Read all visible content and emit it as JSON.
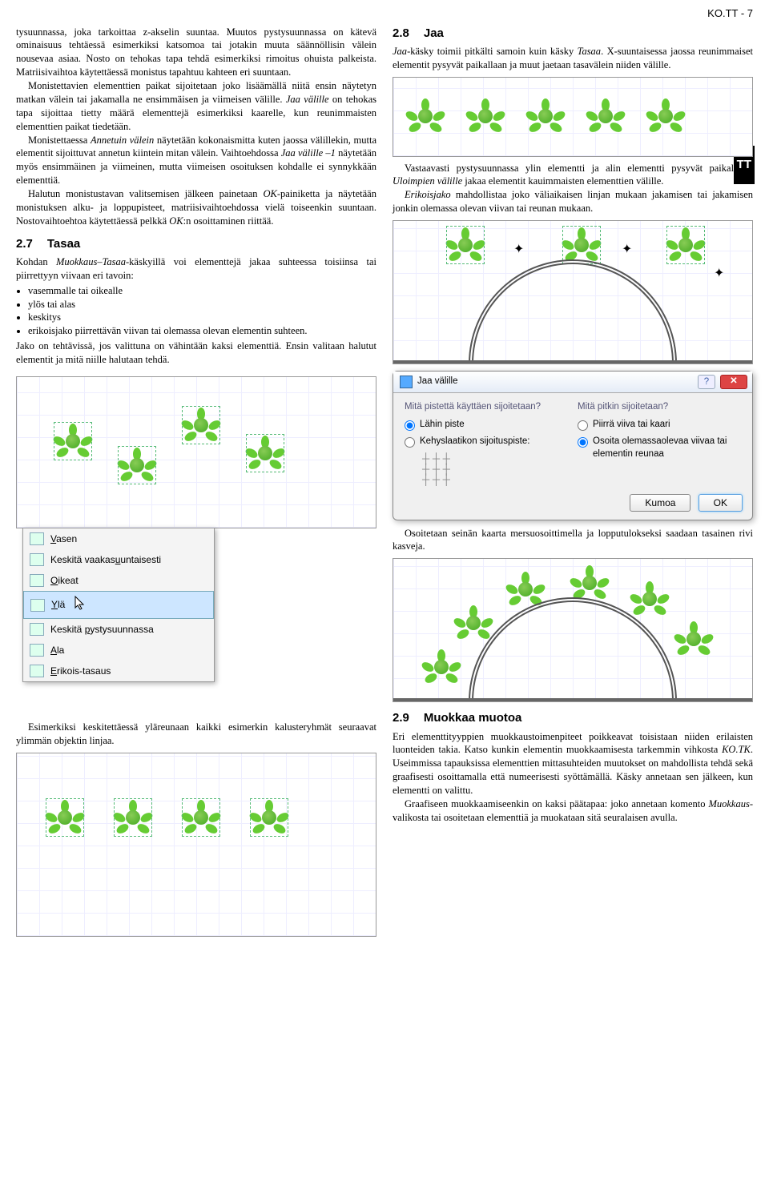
{
  "page_header": "KO.TT - 7",
  "side_tab": "TT",
  "left": {
    "p1": "tysuunnassa, joka tarkoittaa z-akselin suuntaa. Muutos pystysuunnassa on kätevä ominaisuus tehtäessä esimerkiksi katsomoa tai jotakin muuta säännöllisin välein nousevaa asiaa. Nosto on tehokas tapa tehdä esimerkiksi rimoitus ohuista palkeista. Matriisivaihtoa käytettäessä monistus tapahtuu kahteen eri suuntaan.",
    "p2a": "Monistettavien elementtien paikat sijoitetaan joko lisäämällä niitä ensin näytetyn matkan välein tai jakamalla ne ensimmäisen ja viimeisen välille. ",
    "p2b_italic": "Jaa välille",
    "p2c": " on tehokas tapa sijoittaa tietty määrä elementtejä esimerkiksi kaarelle, kun reunimmaisten elementtien paikat tiedetään.",
    "p3a": "Monistettaessa ",
    "p3a_i": "Annetuin välein",
    "p3b": " näytetään kokonaismitta kuten jaossa välillekin, mutta elementit sijoittuvat annetun kiintein mitan välein. Vaihtoehdossa ",
    "p3b_i": "Jaa välille –1",
    "p3c": " näytetään myös ensimmäinen ja viimeinen, mutta viimeisen osoituksen kohdalle ei synnykkään elementtiä.",
    "p4a": "Halutun monistustavan valitsemisen jälkeen painetaan ",
    "p4a_i": "OK",
    "p4b": "-painiketta ja näytetään monistuksen alku- ja loppupisteet, matriisivaihtoehdossa vielä toiseenkin suuntaan. Nostovaihtoehtoa käytettäessä pelkkä ",
    "p4b_i": "OK",
    "p4c": ":n osoittaminen riittää.",
    "sec27_num": "2.7",
    "sec27_title": "Tasaa",
    "p5a": "Kohdan ",
    "p5a_i": "Muokkaus–Tasaa",
    "p5b": "-käskyillä voi elementtejä jakaa suhteessa toisiinsa tai piirrettyyn viivaan eri tavoin:",
    "bullets": [
      "vasemmalle tai oikealle",
      "ylös tai alas",
      "keskitys",
      "erikoisjako piirrettävän viivan tai olemassa olevan elementin suhteen."
    ],
    "p6": "Jako on tehtävissä, jos valittuna on vähintään kaksi elementtiä. Ensin valitaan halutut elementit ja mitä niille halutaan tehdä.",
    "menu_items": [
      {
        "icon": "align-left-icon",
        "label_pre": "",
        "ul": "V",
        "label_post": "asen"
      },
      {
        "icon": "align-hcenter-icon",
        "label_pre": "Keskitä vaakas",
        "ul": "u",
        "label_post": "untaisesti"
      },
      {
        "icon": "align-right-icon",
        "label_pre": "",
        "ul": "O",
        "label_post": "ikeat"
      },
      {
        "icon": "align-top-icon",
        "label_pre": "",
        "ul": "Y",
        "label_post": "lä",
        "highlight": true
      },
      {
        "icon": "align-vcenter-icon",
        "label_pre": "Keskitä ",
        "ul": "p",
        "label_post": "ystysuunnassa"
      },
      {
        "icon": "align-bottom-icon",
        "label_pre": "",
        "ul": "A",
        "label_post": "la"
      },
      {
        "icon": "align-special-icon",
        "label_pre": "",
        "ul": "E",
        "label_post": "rikois-tasaus"
      }
    ],
    "p7": "Esimerkiksi keskitettäessä yläreunaan kaikki esimerkin kalusteryhmät seuraavat ylimmän objektin linjaa."
  },
  "right": {
    "sec28_num": "2.8",
    "sec28_title": "Jaa",
    "p1a_i": "Jaa",
    "p1b": "-käsky toimii pitkälti samoin kuin käsky ",
    "p1b_i": "Tasaa",
    "p1c": ". X-suuntaisessa jaossa reunimmaiset elementit pysyvät paikallaan ja muut jaetaan tasavälein niiden välille.",
    "p2a": "Vastaavasti pystysuunnassa ylin elementti ja alin elementti pysyvät paikallaan. ",
    "p2a_i": "Uloimpien välille",
    "p2b": " jakaa elementit kauimmaisten elementtien välille.",
    "p3a_i": "Erikoisjako",
    "p3b": " mahdollistaa joko väliaikaisen linjan mukaan jakamisen tai jakamisen jonkin olemassa olevan viivan tai reunan mukaan.",
    "dialog": {
      "title": "Jaa välille",
      "left_q": "Mitä pistettä käyttäen sijoitetaan?",
      "opt_lahin": "Lähin piste",
      "opt_kehys": "Kehyslaatikon sijoituspiste:",
      "right_q": "Mitä pitkin sijoitetaan?",
      "opt_piirra": "Piirrä viiva tai kaari",
      "opt_osoita": "Osoita olemassaolevaa viivaa tai elementin reunaa",
      "btn_cancel": "Kumoa",
      "btn_ok": "OK"
    },
    "p4": "Osoitetaan seinän kaarta mersuosoittimella ja lopputulokseksi saadaan tasainen rivi kasveja.",
    "sec29_num": "2.9",
    "sec29_title": "Muokkaa muotoa",
    "p5a": "Eri elementtityyppien muokkaustoimenpiteet poikkeavat toisistaan niiden erilaisten luonteiden takia. Katso kunkin elementin muokkaamisesta tarkemmin vihkosta ",
    "p5a_i": "KO.TK",
    "p5b": ". Useimmissa tapauksissa elementtien mittasuhteiden muutokset on mahdollista tehdä sekä graafisesti osoittamalla että numeerisesti syöttämällä. Käsky annetaan sen jälkeen, kun elementti on valittu.",
    "p6a": "Graafiseen muokkaamiseenkin on kaksi päätapaa: joko annetaan komento ",
    "p6a_i": "Muokkaus",
    "p6b": "-valikosta tai osoitetaan elementtiä ja muokataan sitä seuralaisen avulla."
  }
}
